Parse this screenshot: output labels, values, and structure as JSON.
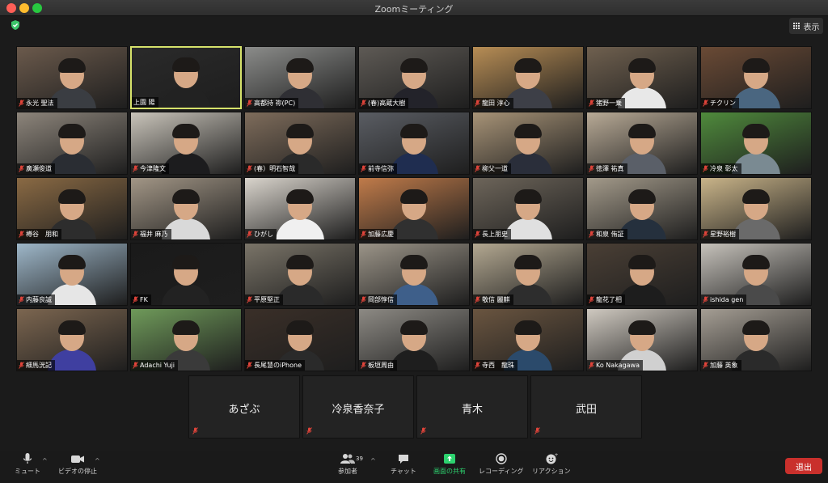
{
  "window": {
    "title": "Zoomミーティング"
  },
  "view_button": {
    "label": "表示"
  },
  "participants": [
    {
      "name": "永光 聖法",
      "bg": "#6b5a4c",
      "shirt": "#3a3d42",
      "active": false
    },
    {
      "name": "上園 陽",
      "bg": "#2a2a2a",
      "shirt": "#222",
      "active": true
    },
    {
      "name": "高都持 祢(PC)",
      "bg": "#8b8c8a",
      "shirt": "#2f2f34",
      "active": false
    },
    {
      "name": "(春)高蔵大樹",
      "bg": "#5e5a55",
      "shirt": "#23232a",
      "active": false
    },
    {
      "name": "龍田 淳心",
      "bg": "#b78d55",
      "shirt": "#3d3f47",
      "active": false
    },
    {
      "name": "猪野一乗",
      "bg": "#6f604f",
      "shirt": "#e8e8e8",
      "active": false
    },
    {
      "name": "チクリン",
      "bg": "#6a4a35",
      "shirt": "#4a6680",
      "active": false
    },
    {
      "name": "廣瀬俊道",
      "bg": "#8d857b",
      "shirt": "#2a2d33",
      "active": false
    },
    {
      "name": "今津隆文",
      "bg": "#c9c4ba",
      "shirt": "#1c1c1e",
      "active": false
    },
    {
      "name": "(春）明石智哉",
      "bg": "#7e6c5b",
      "shirt": "#2a2a2a",
      "active": false
    },
    {
      "name": "前寺信弥",
      "bg": "#5a5d63",
      "shirt": "#1f2d50",
      "active": false
    },
    {
      "name": "柳父一道",
      "bg": "#a79377",
      "shirt": "#2a2e3a",
      "active": false
    },
    {
      "name": "徳澤 祐真",
      "bg": "#b8aa96",
      "shirt": "#5a5f68",
      "active": false
    },
    {
      "name": "冷泉 彰太",
      "bg": "#4f8a3c",
      "shirt": "#7a8a92",
      "active": false
    },
    {
      "name": "樽谷　朋和",
      "bg": "#8a6a44",
      "shirt": "#2d2d2d",
      "active": false
    },
    {
      "name": "福井 麻乃",
      "bg": "#a29686",
      "shirt": "#d9d9d9",
      "active": false
    },
    {
      "name": "ひがし",
      "bg": "#d9d4cc",
      "shirt": "#f0f0f0",
      "active": false
    },
    {
      "name": "加藤広慶",
      "bg": "#c07b4a",
      "shirt": "#303030",
      "active": false
    },
    {
      "name": "長上朋史",
      "bg": "#6d655a",
      "shirt": "#e0e0e0",
      "active": false
    },
    {
      "name": "和泉 侑証",
      "bg": "#a39a8a",
      "shirt": "#25303d",
      "active": false
    },
    {
      "name": "星野裕樹",
      "bg": "#c9b489",
      "shirt": "#6a6a6a",
      "active": false
    },
    {
      "name": "内藤良誠",
      "bg": "#9eb7c9",
      "shirt": "#e6e6e6",
      "active": false
    },
    {
      "name": "FK",
      "bg": "#1a1a1a",
      "shirt": "#222",
      "active": false
    },
    {
      "name": "平原堅正",
      "bg": "#7a7468",
      "shirt": "#2a2a2a",
      "active": false
    },
    {
      "name": "岡部惇信",
      "bg": "#9b9488",
      "shirt": "#3e5f8a",
      "active": false
    },
    {
      "name": "敬信 麗麒",
      "bg": "#b3a891",
      "shirt": "#2d2d2d",
      "active": false
    },
    {
      "name": "龍花了相",
      "bg": "#4a3f35",
      "shirt": "#1d1d1d",
      "active": false
    },
    {
      "name": "ishida gen",
      "bg": "#c6c2bb",
      "shirt": "#4a4a4a",
      "active": false
    },
    {
      "name": "細馬洸記",
      "bg": "#7c6650",
      "shirt": "#3f3fa0",
      "active": false
    },
    {
      "name": "Adachi Yuji",
      "bg": "#6f9a5a",
      "shirt": "#3a3a3a",
      "active": false
    },
    {
      "name": "長尾慧のiPhone",
      "bg": "#3a2f28",
      "shirt": "#2a2a2a",
      "active": false
    },
    {
      "name": "板垣周由",
      "bg": "#8d8a84",
      "shirt": "#1e1e1e",
      "active": false
    },
    {
      "name": "寺西　龍珠",
      "bg": "#6a5540",
      "shirt": "#2b4a6b",
      "active": false
    },
    {
      "name": "Ko Nakagawa",
      "bg": "#cfc9c0",
      "shirt": "#d0d0d0",
      "active": false
    },
    {
      "name": "加藤 英象",
      "bg": "#a59e94",
      "shirt": "#2a2a2a",
      "active": false
    }
  ],
  "name_only": [
    "あざぶ",
    "冷泉香奈子",
    "青木",
    "武田"
  ],
  "toolbar": {
    "mute": "ミュート",
    "video": "ビデオの停止",
    "participants": "参加者",
    "participants_count": "39",
    "chat": "チャット",
    "share": "画面の共有",
    "record": "レコーディング",
    "reactions": "リアクション",
    "leave": "退出",
    "share_color": "#2dd36f",
    "leave_color": "#c9302c"
  }
}
